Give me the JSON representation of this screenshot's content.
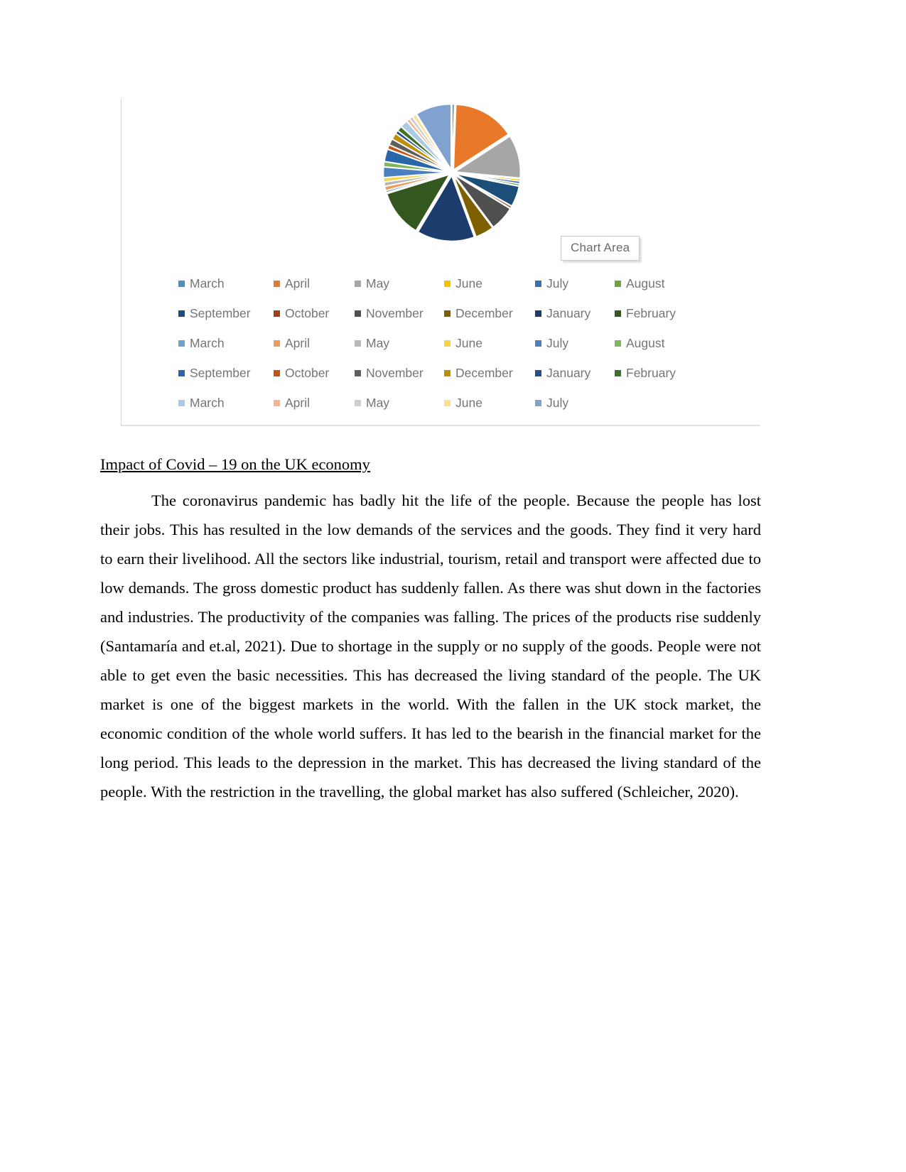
{
  "document": {
    "section_heading": "Impact of Covid – 19 on the UK economy",
    "body_paragraph": "The coronavirus pandemic has badly hit the life of the people. Because the people has lost their jobs. This has resulted in the low demands of the services and the goods. They find it very hard to earn their livelihood. All the sectors like industrial, tourism, retail and transport were affected due to low demands. The gross domestic product has suddenly fallen. As there was shut down in the factories and industries. The productivity of the companies was falling. The prices of the products rise suddenly (Santamaría and et.al, 2021). Due to shortage in the supply or no supply of the goods. People were not able to get even the basic necessities. This has decreased the living standard of the people. The UK market is one of the biggest markets in the world. With the fallen in the UK stock market, the economic condition of the whole world suffers. It has led to the bearish in the financial market for the long period. This leads to the depression in the market. This has decreased the living standard of the people. With the restriction in the travelling, the global market has also suffered (Schleicher, 2020)."
  },
  "chart_object": {
    "tooltip_label": "Chart Area"
  },
  "chart_data": {
    "type": "pie",
    "title": "",
    "legend_position": "bottom",
    "grid": false,
    "exploded": true,
    "labels": [
      "March",
      "April",
      "May",
      "June",
      "July",
      "August",
      "September",
      "October",
      "November",
      "December",
      "January",
      "February",
      "March",
      "April",
      "May",
      "June",
      "July",
      "August",
      "September",
      "October",
      "November",
      "December",
      "January",
      "February",
      "March",
      "April",
      "May",
      "June",
      "July"
    ],
    "colors": [
      "#4a90c4",
      "#e8792b",
      "#a6a6a6",
      "#f4c000",
      "#3a6fb8",
      "#6fa342",
      "#1b4e79",
      "#9c4216",
      "#505050",
      "#7e6000",
      "#1c3c6e",
      "#34561f",
      "#6ba4cf",
      "#ed9c5a",
      "#b8b8b8",
      "#f9d24b",
      "#4a7fc1",
      "#7fb659",
      "#2766a8",
      "#c3550f",
      "#5e5e5e",
      "#bd8f06",
      "#21518f",
      "#3d7226",
      "#a9cbe3",
      "#f2b58c",
      "#cfcfcf",
      "#fbe08e",
      "#7fa2d1"
    ],
    "values": [
      0.6,
      15.0,
      10.5,
      0.5,
      0.6,
      0.5,
      5.0,
      0.5,
      6.0,
      4.5,
      14.0,
      11.5,
      0.5,
      1.0,
      1.0,
      1.0,
      2.5,
      1.2,
      3.0,
      1.0,
      1.5,
      1.5,
      0.8,
      1.2,
      1.8,
      0.8,
      0.9,
      0.9,
      8.7
    ],
    "legend_rows": [
      [
        {
          "label": "March",
          "color": "#4a90c4"
        },
        {
          "label": "April",
          "color": "#e8792b"
        },
        {
          "label": "May",
          "color": "#a6a6a6"
        },
        {
          "label": "June",
          "color": "#f4c000"
        },
        {
          "label": "July",
          "color": "#3a6fb8"
        },
        {
          "label": "August",
          "color": "#6fa342"
        }
      ],
      [
        {
          "label": "September",
          "color": "#1b4e79"
        },
        {
          "label": "October",
          "color": "#9c4216"
        },
        {
          "label": "November",
          "color": "#505050"
        },
        {
          "label": "December",
          "color": "#7e6000"
        },
        {
          "label": "January",
          "color": "#1c3c6e"
        },
        {
          "label": "February",
          "color": "#34561f"
        }
      ],
      [
        {
          "label": "March",
          "color": "#6ba4cf"
        },
        {
          "label": "April",
          "color": "#ed9c5a"
        },
        {
          "label": "May",
          "color": "#b8b8b8"
        },
        {
          "label": "June",
          "color": "#f9d24b"
        },
        {
          "label": "July",
          "color": "#4a7fc1"
        },
        {
          "label": "August",
          "color": "#7fb659"
        }
      ],
      [
        {
          "label": "September",
          "color": "#2766a8"
        },
        {
          "label": "October",
          "color": "#c3550f"
        },
        {
          "label": "November",
          "color": "#5e5e5e"
        },
        {
          "label": "December",
          "color": "#bd8f06"
        },
        {
          "label": "January",
          "color": "#21518f"
        },
        {
          "label": "February",
          "color": "#3d7226"
        }
      ],
      [
        {
          "label": "March",
          "color": "#a9cbe3"
        },
        {
          "label": "April",
          "color": "#f2b58c"
        },
        {
          "label": "May",
          "color": "#cfcfcf"
        },
        {
          "label": "June",
          "color": "#fbe08e"
        },
        {
          "label": "July",
          "color": "#7fa2d1"
        }
      ]
    ]
  }
}
